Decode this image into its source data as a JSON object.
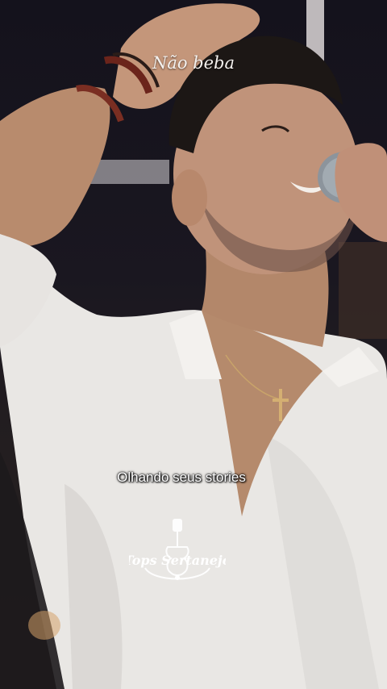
{
  "video": {
    "title_text": "Não beba",
    "subtitle_text": "Olhando seus stories",
    "watermark_text": "Tops Sertanejo"
  }
}
